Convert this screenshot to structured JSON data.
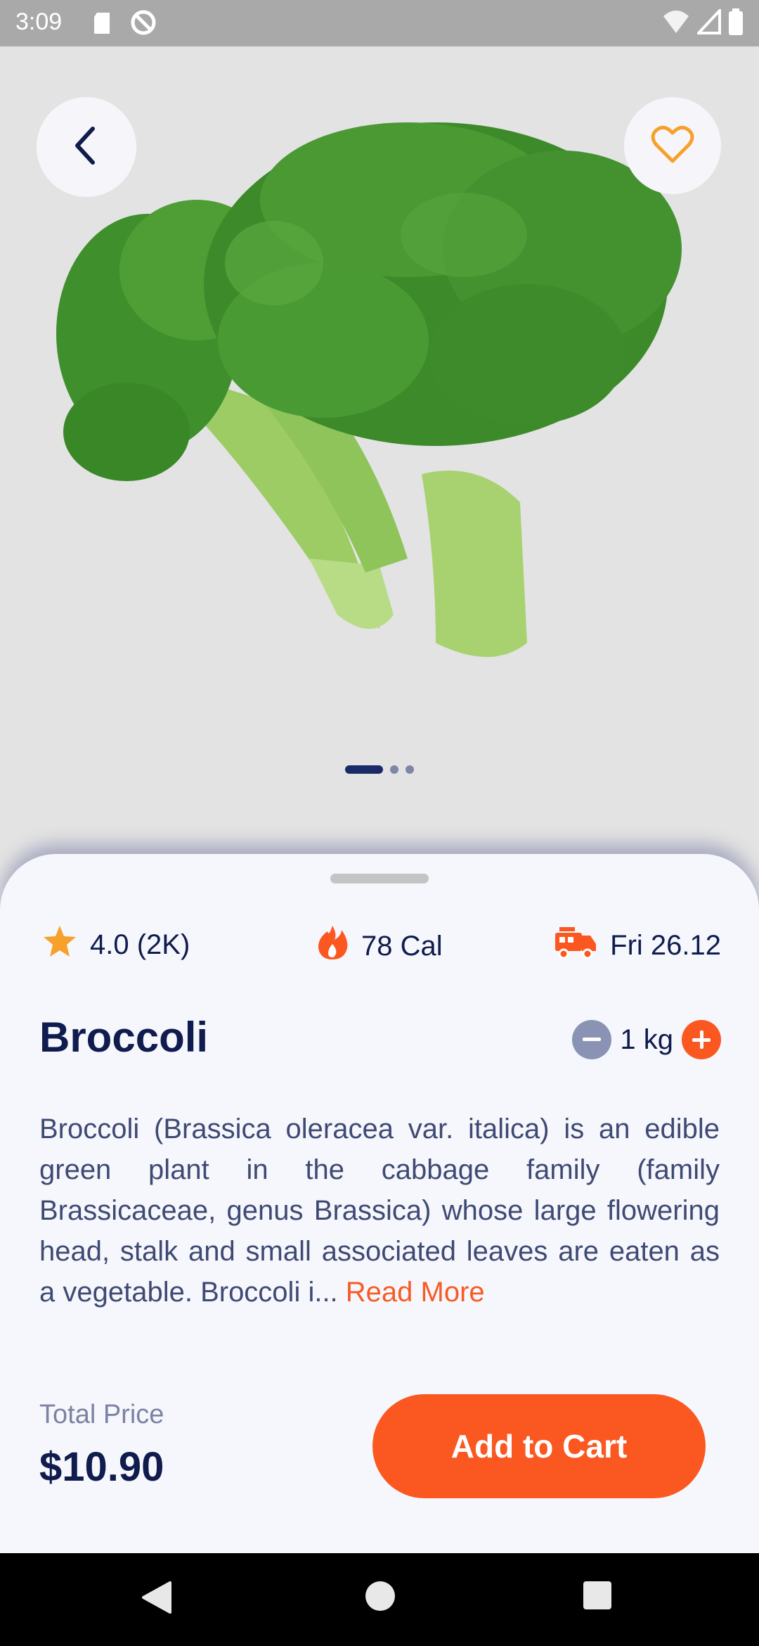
{
  "status_bar": {
    "time": "3:09",
    "icons": [
      "sd-card-icon",
      "dnd-icon",
      "wifi-off-icon",
      "signal-icon",
      "battery-icon"
    ]
  },
  "hero": {
    "image": "broccoli",
    "carousel": {
      "count": 3,
      "active": 0
    }
  },
  "stats": {
    "rating": "4.0 (2K)",
    "calories": "78 Cal",
    "delivery": "Fri 26.12"
  },
  "product": {
    "name": "Broccoli",
    "quantity": "1 kg",
    "description": "Broccoli (Brassica oleracea var. italica) is an edible green plant in the cabbage family (family Brassicaceae, genus Brassica) whose large flowering head, stalk and small associated leaves are eaten as a vegetable. Broccoli i...",
    "read_more": "Read More"
  },
  "footer": {
    "total_label": "Total Price",
    "total_value": "$10.90",
    "add_to_cart": "Add to Cart"
  },
  "colors": {
    "accent": "#fb5720",
    "navy": "#0f1c4d",
    "star": "#f7a02c"
  }
}
